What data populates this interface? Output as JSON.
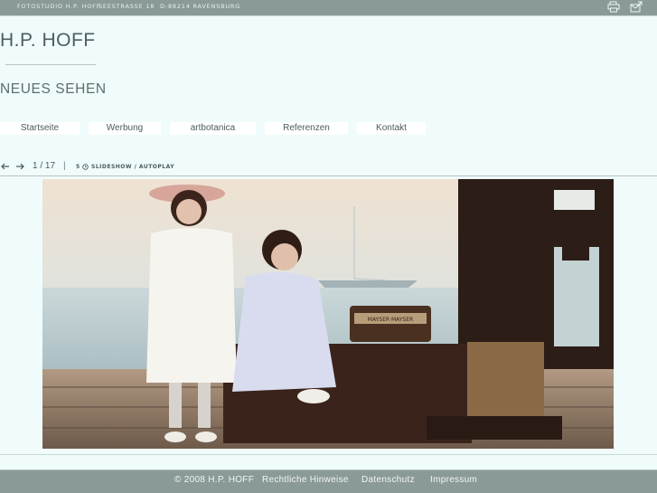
{
  "topbar": {
    "address_studio": "Fotostudio H.P. Hoff",
    "address_street": "Seestraße 18",
    "address_city": "D-88214 Ravensburg",
    "icons": [
      "printer-icon",
      "mail-icon"
    ]
  },
  "header": {
    "title": "H.P. HOFF",
    "tagline": "NEUES SEHEN"
  },
  "nav": {
    "items": [
      {
        "label": "Startseite"
      },
      {
        "label": "Werbung"
      },
      {
        "label": "artbotanica"
      },
      {
        "label": "Referenzen"
      },
      {
        "label": "Kontakt"
      }
    ]
  },
  "slideshow": {
    "counter": "1 / 17",
    "separator": "|",
    "interval": "5",
    "label": "Slideshow / Autoplay",
    "icons": [
      "arrow-left-icon",
      "arrow-right-icon",
      "clock-icon"
    ]
  },
  "photo": {
    "description_icon": "photo-image",
    "trunk_label": "MAYSER·MAYSER"
  },
  "footer": {
    "copyright": "© 2008 H.P. HOFF",
    "link_legal": "Rechtliche Hinweise",
    "link_privacy": "Datenschutz",
    "link_imprint": "Impressum"
  },
  "colors": {
    "background": "#effcfb",
    "bar": "#8a9a97",
    "text": "#4b5a5c"
  }
}
